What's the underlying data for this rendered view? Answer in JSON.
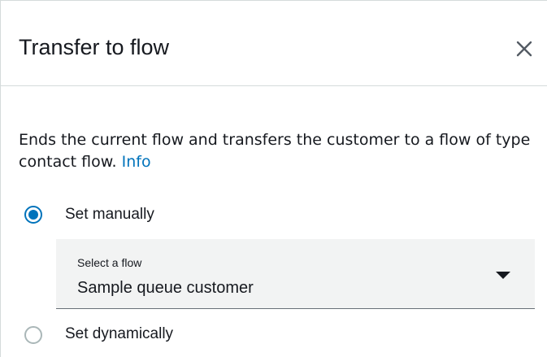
{
  "dialog": {
    "title": "Transfer to flow",
    "close_icon": "close-icon"
  },
  "description": {
    "text": "Ends the current flow and transfers the customer to a flow of type contact flow.",
    "info_link": "Info"
  },
  "options": {
    "manual": {
      "label": "Set manually",
      "selected": true
    },
    "dynamic": {
      "label": "Set dynamically",
      "selected": false
    }
  },
  "flow_select": {
    "caption": "Select a flow",
    "value": "Sample queue customer",
    "icon": "chevron-down-icon"
  },
  "colors": {
    "accent": "#0073bb",
    "text": "#16191f",
    "select_bg": "#f2f3f3",
    "divider": "#d5dbdb"
  }
}
